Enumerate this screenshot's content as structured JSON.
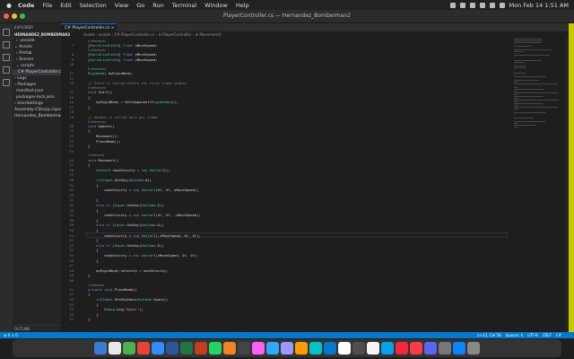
{
  "menubar": {
    "app_name": "Code",
    "items": [
      "File",
      "Edit",
      "Selection",
      "View",
      "Go",
      "Run",
      "Terminal",
      "Window",
      "Help"
    ],
    "clock": "Mon Feb 14  1:51 AM"
  },
  "window": {
    "title": "PlayerController.cs — Hernandez_Bomberman2"
  },
  "sidebar": {
    "header": "EXPLORER",
    "project": "HERNANDEZ_BOMBERMAN2",
    "items": [
      {
        "label": "› .vscode",
        "indent": 4
      },
      {
        "label": "⌄ Assets",
        "indent": 2
      },
      {
        "label": "› Prefab",
        "indent": 4
      },
      {
        "label": "› Scenes",
        "indent": 4
      },
      {
        "label": "⌄ scripts",
        "indent": 4
      },
      {
        "label": "C# PlayerController.cs",
        "indent": 6,
        "active": true
      },
      {
        "label": "› Logs",
        "indent": 2
      },
      {
        "label": "› Packages",
        "indent": 2
      },
      {
        "label": "manifest.json",
        "indent": 4
      },
      {
        "label": "packages-lock.json",
        "indent": 4
      },
      {
        "label": "› UserSettings",
        "indent": 2
      },
      {
        "label": "Assembly-CSharp.csproj",
        "indent": 2
      },
      {
        "label": "Hernandez_Bomberman2.sln",
        "indent": 2
      }
    ],
    "outline": "OUTLINE"
  },
  "tab": {
    "label": "C# PlayerController.cs ×"
  },
  "breadcrumb": "Assets › scripts › C# PlayerController.cs › ⚙ PlayerController › ⚙ Movement()",
  "code_lines": [
    {
      "n": "",
      "text": "0 references",
      "lens": true
    },
    {
      "n": "7",
      "text": "[SerializeField] float xMoveSpeed;"
    },
    {
      "n": "",
      "text": "0 references",
      "lens": true
    },
    {
      "n": "8",
      "text": "[SerializeField] float yMoveSpeed;"
    },
    {
      "n": "9",
      "text": "[SerializeField] float zMoveSpeed;"
    },
    {
      "n": "10",
      "text": ""
    },
    {
      "n": "",
      "text": "6 references",
      "lens": true
    },
    {
      "n": "11",
      "text": "Rigidbody myRigidBody;"
    },
    {
      "n": "12",
      "text": ""
    },
    {
      "n": "13",
      "text": "// Start is called before the first frame update"
    },
    {
      "n": "",
      "text": "0 references",
      "lens": true
    },
    {
      "n": "14",
      "text": "void Start()"
    },
    {
      "n": "15",
      "text": "{"
    },
    {
      "n": "16",
      "text": "    myRigidBody = GetComponent<Rigidbody>();"
    },
    {
      "n": "17",
      "text": "}"
    },
    {
      "n": "18",
      "text": ""
    },
    {
      "n": "19",
      "text": "// Update is called once per frame"
    },
    {
      "n": "",
      "text": "0 references",
      "lens": true
    },
    {
      "n": "20",
      "text": "void Update()"
    },
    {
      "n": "21",
      "text": "{"
    },
    {
      "n": "22",
      "text": "    Movement();"
    },
    {
      "n": "23",
      "text": "    PlaceBomb();"
    },
    {
      "n": "24",
      "text": "}"
    },
    {
      "n": "25",
      "text": ""
    },
    {
      "n": "",
      "text": "1 reference",
      "lens": true
    },
    {
      "n": "26",
      "text": "void Movement()"
    },
    {
      "n": "27",
      "text": "{"
    },
    {
      "n": "28",
      "text": "    Vector3 newVelocity = new Vector3();"
    },
    {
      "n": "29",
      "text": ""
    },
    {
      "n": "30",
      "text": "    if(Input.GetKey(KeyCode.W))"
    },
    {
      "n": "31",
      "text": "    {"
    },
    {
      "n": "32",
      "text": "        newVelocity = new Vector3(0f, 0f, xMoveSpeed);"
    },
    {
      "n": "33",
      "text": ""
    },
    {
      "n": "34",
      "text": "    }"
    },
    {
      "n": "35",
      "text": "    else if (Input.GetKey(KeyCode.S))"
    },
    {
      "n": "36",
      "text": "    {"
    },
    {
      "n": "37",
      "text": "        newVelocity = new Vector3(0f, 0f, -xMoveSpeed);"
    },
    {
      "n": "38",
      "text": "    }"
    },
    {
      "n": "39",
      "text": "    else if (Input.GetKey(KeyCode.A))"
    },
    {
      "n": "40",
      "text": "    {"
    },
    {
      "n": "41",
      "text": "        newVelocity = new Vector3(-zMoveSpeed, 0f, 0f);",
      "current": true
    },
    {
      "n": "42",
      "text": "    }"
    },
    {
      "n": "43",
      "text": "    else if (Input.GetKey(KeyCode.D))"
    },
    {
      "n": "44",
      "text": "    {"
    },
    {
      "n": "45",
      "text": "        newVelocity = new Vector3(zMoveSpeed, 0f, 0f);"
    },
    {
      "n": "46",
      "text": "    }"
    },
    {
      "n": "47",
      "text": ""
    },
    {
      "n": "48",
      "text": "    myRigidBody.velocity = newVelocity;"
    },
    {
      "n": "49",
      "text": "}"
    },
    {
      "n": "50",
      "text": ""
    },
    {
      "n": "",
      "text": "1 reference",
      "lens": true
    },
    {
      "n": "51",
      "text": "private void PlaceBomb()"
    },
    {
      "n": "52",
      "text": "{"
    },
    {
      "n": "53",
      "text": "    if(Input.GetKeyDown(KeyCode.Space))"
    },
    {
      "n": "54",
      "text": "    {"
    },
    {
      "n": "55",
      "text": "        Debug.Log(\"Boom!\");"
    },
    {
      "n": "56",
      "text": "    }"
    },
    {
      "n": "57",
      "text": "}"
    }
  ],
  "status": {
    "left": "⊗ 0 ⚠ 0",
    "cursor": "Ln 41, Col 58",
    "spaces": "Spaces: 4",
    "encoding": "UTF-8",
    "eol": "CRLF",
    "language": "C#"
  },
  "dock_colors": [
    "#3a7bd5",
    "#e8e8e8",
    "#4caf50",
    "#ea4335",
    "#2d8cff",
    "#2b579a",
    "#217346",
    "#c43e1c",
    "#1ed760",
    "#f58220",
    "#444",
    "#ff61f6",
    "#31a8ff",
    "#9999ff",
    "#ff9a00",
    "#00c4cc",
    "#007acc",
    "#fff",
    "#4e4e4e",
    "#f5f5f5",
    "#00a4ef",
    "#fa243c",
    "#fc3c44",
    "#5865f2",
    "#777",
    "#0a84ff",
    "#888"
  ]
}
